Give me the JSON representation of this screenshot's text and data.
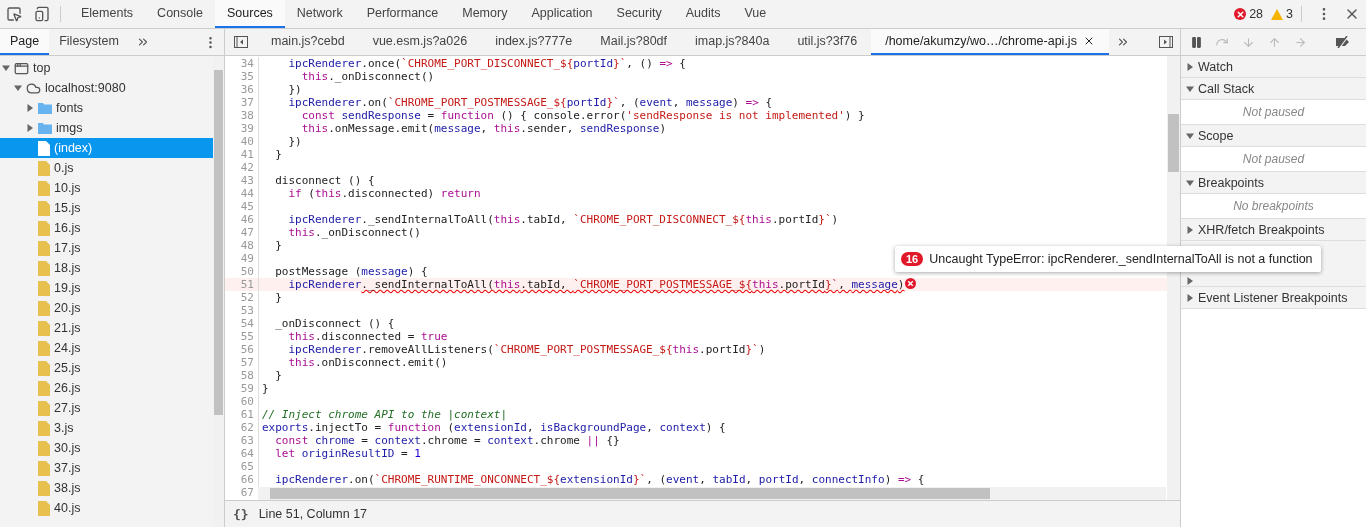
{
  "toolbar": {
    "tabs": [
      {
        "label": "Elements",
        "selected": false
      },
      {
        "label": "Console",
        "selected": false
      },
      {
        "label": "Sources",
        "selected": true
      },
      {
        "label": "Network",
        "selected": false
      },
      {
        "label": "Performance",
        "selected": false
      },
      {
        "label": "Memory",
        "selected": false
      },
      {
        "label": "Application",
        "selected": false
      },
      {
        "label": "Security",
        "selected": false
      },
      {
        "label": "Audits",
        "selected": false
      },
      {
        "label": "Vue",
        "selected": false
      }
    ],
    "errors": "28",
    "warnings": "3"
  },
  "navigator": {
    "tabs": [
      {
        "label": "Page",
        "selected": true
      },
      {
        "label": "Filesystem",
        "selected": false
      }
    ],
    "tree": [
      {
        "label": "top",
        "kind": "frame",
        "expanded": true,
        "selected": false,
        "children": [
          {
            "label": "localhost:9080",
            "kind": "domain",
            "expanded": true,
            "selected": false,
            "children": [
              {
                "label": "fonts",
                "kind": "folder",
                "expanded": false,
                "selected": false
              },
              {
                "label": "imgs",
                "kind": "folder",
                "expanded": false,
                "selected": false
              },
              {
                "label": "(index)",
                "kind": "document",
                "selected": true
              },
              {
                "label": "0.js",
                "kind": "script",
                "selected": false
              },
              {
                "label": "10.js",
                "kind": "script",
                "selected": false
              },
              {
                "label": "15.js",
                "kind": "script",
                "selected": false
              },
              {
                "label": "16.js",
                "kind": "script",
                "selected": false
              },
              {
                "label": "17.js",
                "kind": "script",
                "selected": false
              },
              {
                "label": "18.js",
                "kind": "script",
                "selected": false
              },
              {
                "label": "19.js",
                "kind": "script",
                "selected": false
              },
              {
                "label": "20.js",
                "kind": "script",
                "selected": false
              },
              {
                "label": "21.js",
                "kind": "script",
                "selected": false
              },
              {
                "label": "24.js",
                "kind": "script",
                "selected": false
              },
              {
                "label": "25.js",
                "kind": "script",
                "selected": false
              },
              {
                "label": "26.js",
                "kind": "script",
                "selected": false
              },
              {
                "label": "27.js",
                "kind": "script",
                "selected": false
              },
              {
                "label": "3.js",
                "kind": "script",
                "selected": false
              },
              {
                "label": "30.js",
                "kind": "script",
                "selected": false
              },
              {
                "label": "37.js",
                "kind": "script",
                "selected": false
              },
              {
                "label": "38.js",
                "kind": "script",
                "selected": false
              },
              {
                "label": "40.js",
                "kind": "script",
                "selected": false
              }
            ]
          }
        ]
      }
    ]
  },
  "editor": {
    "tabs": [
      {
        "label": "main.js?cebd",
        "selected": false
      },
      {
        "label": "vue.esm.js?a026",
        "selected": false
      },
      {
        "label": "index.js?777e",
        "selected": false
      },
      {
        "label": "Mail.js?80df",
        "selected": false
      },
      {
        "label": "imap.js?840a",
        "selected": false
      },
      {
        "label": "util.js?3f76",
        "selected": false
      },
      {
        "label": "/home/akumzy/wo…/chrome-api.js",
        "selected": true
      }
    ],
    "lines": [
      {
        "number": "34",
        "tokens": [
          {
            "kind": "variable",
            "text": "    ipcRenderer"
          },
          {
            "kind": "plain",
            "text": ".once("
          },
          {
            "kind": "string",
            "text": "`CHROME_PORT_DISCONNECT_${"
          },
          {
            "kind": "variable",
            "text": "portId"
          },
          {
            "kind": "string",
            "text": "}`"
          },
          {
            "kind": "plain",
            "text": ", () "
          },
          {
            "kind": "keyword",
            "text": "=>"
          },
          {
            "kind": "plain",
            "text": " {"
          }
        ]
      },
      {
        "number": "35",
        "tokens": [
          {
            "kind": "keyword",
            "text": "      this"
          },
          {
            "kind": "plain",
            "text": "._onDisconnect()"
          }
        ]
      },
      {
        "number": "36",
        "tokens": [
          {
            "kind": "plain",
            "text": "    })"
          }
        ]
      },
      {
        "number": "37",
        "tokens": [
          {
            "kind": "variable",
            "text": "    ipcRenderer"
          },
          {
            "kind": "plain",
            "text": ".on("
          },
          {
            "kind": "string",
            "text": "`CHROME_PORT_POSTMESSAGE_${"
          },
          {
            "kind": "variable",
            "text": "portId"
          },
          {
            "kind": "string",
            "text": "}`"
          },
          {
            "kind": "plain",
            "text": ", ("
          },
          {
            "kind": "variable",
            "text": "event"
          },
          {
            "kind": "plain",
            "text": ", "
          },
          {
            "kind": "variable",
            "text": "message"
          },
          {
            "kind": "plain",
            "text": ") "
          },
          {
            "kind": "keyword",
            "text": "=>"
          },
          {
            "kind": "plain",
            "text": " {"
          }
        ]
      },
      {
        "number": "38",
        "tokens": [
          {
            "kind": "keyword",
            "text": "      const "
          },
          {
            "kind": "variable",
            "text": "sendResponse"
          },
          {
            "kind": "plain",
            "text": " = "
          },
          {
            "kind": "keyword",
            "text": "function"
          },
          {
            "kind": "plain",
            "text": " () { console.error("
          },
          {
            "kind": "string",
            "text": "'sendResponse is not implemented'"
          },
          {
            "kind": "plain",
            "text": ") }"
          }
        ]
      },
      {
        "number": "39",
        "tokens": [
          {
            "kind": "keyword",
            "text": "      this"
          },
          {
            "kind": "plain",
            "text": ".onMessage.emit("
          },
          {
            "kind": "variable",
            "text": "message"
          },
          {
            "kind": "plain",
            "text": ", "
          },
          {
            "kind": "keyword",
            "text": "this"
          },
          {
            "kind": "plain",
            "text": ".sender, "
          },
          {
            "kind": "variable",
            "text": "sendResponse"
          },
          {
            "kind": "plain",
            "text": ")"
          }
        ]
      },
      {
        "number": "40",
        "tokens": [
          {
            "kind": "plain",
            "text": "    })"
          }
        ]
      },
      {
        "number": "41",
        "tokens": [
          {
            "kind": "plain",
            "text": "  }"
          }
        ]
      },
      {
        "number": "42"
      },
      {
        "number": "43",
        "tokens": [
          {
            "kind": "plain",
            "text": "  disconnect () {"
          }
        ]
      },
      {
        "number": "44",
        "tokens": [
          {
            "kind": "keyword",
            "text": "    if"
          },
          {
            "kind": "plain",
            "text": " ("
          },
          {
            "kind": "keyword",
            "text": "this"
          },
          {
            "kind": "plain",
            "text": ".disconnected) "
          },
          {
            "kind": "keyword",
            "text": "return"
          }
        ]
      },
      {
        "number": "45"
      },
      {
        "number": "46",
        "tokens": [
          {
            "kind": "variable",
            "text": "    ipcRenderer"
          },
          {
            "kind": "plain",
            "text": "._sendInternalToAll("
          },
          {
            "kind": "keyword",
            "text": "this"
          },
          {
            "kind": "plain",
            "text": ".tabId, "
          },
          {
            "kind": "string",
            "text": "`CHROME_PORT_DISCONNECT_${"
          },
          {
            "kind": "keyword",
            "text": "this"
          },
          {
            "kind": "plain",
            "text": ".portId"
          },
          {
            "kind": "string",
            "text": "}`"
          },
          {
            "kind": "plain",
            "text": ")"
          }
        ]
      },
      {
        "number": "47",
        "tokens": [
          {
            "kind": "keyword",
            "text": "    this"
          },
          {
            "kind": "plain",
            "text": "._onDisconnect()"
          }
        ]
      },
      {
        "number": "48",
        "tokens": [
          {
            "kind": "plain",
            "text": "  }"
          }
        ]
      },
      {
        "number": "49"
      },
      {
        "number": "50",
        "tokens": [
          {
            "kind": "plain",
            "text": "  postMessage ("
          },
          {
            "kind": "variable",
            "text": "message"
          },
          {
            "kind": "plain",
            "text": ") {"
          }
        ]
      },
      {
        "number": "51",
        "error": true,
        "tokens": [
          {
            "kind": "variable",
            "text": "    ipcRenderer"
          },
          {
            "kind": "plain",
            "text": "._sendInternalToAll("
          },
          {
            "kind": "keyword",
            "text": "this"
          },
          {
            "kind": "plain",
            "text": ".tabId, "
          },
          {
            "kind": "string",
            "text": "`CHROME_PORT_POSTMESSAGE_${"
          },
          {
            "kind": "keyword",
            "text": "this"
          },
          {
            "kind": "plain",
            "text": ".portId"
          },
          {
            "kind": "string",
            "text": "}`"
          },
          {
            "kind": "plain",
            "text": ", "
          },
          {
            "kind": "variable",
            "text": "message"
          },
          {
            "kind": "plain",
            "text": ")"
          }
        ]
      },
      {
        "number": "52",
        "tokens": [
          {
            "kind": "plain",
            "text": "  }"
          }
        ]
      },
      {
        "number": "53"
      },
      {
        "number": "54",
        "tokens": [
          {
            "kind": "plain",
            "text": "  _onDisconnect () {"
          }
        ]
      },
      {
        "number": "55",
        "tokens": [
          {
            "kind": "keyword",
            "text": "    this"
          },
          {
            "kind": "plain",
            "text": ".disconnected = "
          },
          {
            "kind": "keyword",
            "text": "true"
          }
        ]
      },
      {
        "number": "56",
        "tokens": [
          {
            "kind": "variable",
            "text": "    ipcRenderer"
          },
          {
            "kind": "plain",
            "text": ".removeAllListeners("
          },
          {
            "kind": "string",
            "text": "`CHROME_PORT_POSTMESSAGE_${"
          },
          {
            "kind": "keyword",
            "text": "this"
          },
          {
            "kind": "plain",
            "text": ".portId"
          },
          {
            "kind": "string",
            "text": "}`"
          },
          {
            "kind": "plain",
            "text": ")"
          }
        ]
      },
      {
        "number": "57",
        "tokens": [
          {
            "kind": "keyword",
            "text": "    this"
          },
          {
            "kind": "plain",
            "text": ".onDisconnect.emit()"
          }
        ]
      },
      {
        "number": "58",
        "tokens": [
          {
            "kind": "plain",
            "text": "  }"
          }
        ]
      },
      {
        "number": "59",
        "tokens": [
          {
            "kind": "plain",
            "text": "}"
          }
        ]
      },
      {
        "number": "60"
      },
      {
        "number": "61",
        "tokens": [
          {
            "kind": "comment",
            "text": "// Inject chrome API to the |context|"
          }
        ]
      },
      {
        "number": "62",
        "tokens": [
          {
            "kind": "variable",
            "text": "exports"
          },
          {
            "kind": "plain",
            "text": ".injectTo = "
          },
          {
            "kind": "keyword",
            "text": "function"
          },
          {
            "kind": "plain",
            "text": " ("
          },
          {
            "kind": "variable",
            "text": "extensionId"
          },
          {
            "kind": "plain",
            "text": ", "
          },
          {
            "kind": "variable",
            "text": "isBackgroundPage"
          },
          {
            "kind": "plain",
            "text": ", "
          },
          {
            "kind": "variable",
            "text": "context"
          },
          {
            "kind": "plain",
            "text": ") {"
          }
        ]
      },
      {
        "number": "63",
        "tokens": [
          {
            "kind": "keyword",
            "text": "  const "
          },
          {
            "kind": "variable",
            "text": "chrome"
          },
          {
            "kind": "plain",
            "text": " = "
          },
          {
            "kind": "variable",
            "text": "context"
          },
          {
            "kind": "plain",
            "text": ".chrome = "
          },
          {
            "kind": "variable",
            "text": "context"
          },
          {
            "kind": "plain",
            "text": ".chrome "
          },
          {
            "kind": "keyword",
            "text": "||"
          },
          {
            "kind": "plain",
            "text": " {}"
          }
        ]
      },
      {
        "number": "64",
        "tokens": [
          {
            "kind": "keyword",
            "text": "  let "
          },
          {
            "kind": "variable",
            "text": "originResultID"
          },
          {
            "kind": "plain",
            "text": " = "
          },
          {
            "kind": "number",
            "text": "1"
          }
        ]
      },
      {
        "number": "65"
      },
      {
        "number": "66",
        "tokens": [
          {
            "kind": "variable",
            "text": "  ipcRenderer"
          },
          {
            "kind": "plain",
            "text": ".on("
          },
          {
            "kind": "string",
            "text": "`CHROME_RUNTIME_ONCONNECT_${"
          },
          {
            "kind": "variable",
            "text": "extensionId"
          },
          {
            "kind": "string",
            "text": "}`"
          },
          {
            "kind": "plain",
            "text": ", ("
          },
          {
            "kind": "variable",
            "text": "event"
          },
          {
            "kind": "plain",
            "text": ", "
          },
          {
            "kind": "variable",
            "text": "tabId"
          },
          {
            "kind": "plain",
            "text": ", "
          },
          {
            "kind": "variable",
            "text": "portId"
          },
          {
            "kind": "plain",
            "text": ", "
          },
          {
            "kind": "variable",
            "text": "connectInfo"
          },
          {
            "kind": "plain",
            "text": ") "
          },
          {
            "kind": "keyword",
            "text": "=>"
          },
          {
            "kind": "plain",
            "text": " {"
          }
        ]
      },
      {
        "number": "67"
      }
    ],
    "format_button": "{}",
    "status": "Line 51, Column 17"
  },
  "tooltip": {
    "count": "16",
    "message": "Uncaught TypeError: ipcRenderer._sendInternalToAll is not a function"
  },
  "debugger": {
    "sections": [
      {
        "title": "Watch",
        "expanded": false
      },
      {
        "title": "Call Stack",
        "expanded": true,
        "message": "Not paused"
      },
      {
        "title": "Scope",
        "expanded": true,
        "message": "Not paused"
      },
      {
        "title": "Breakpoints",
        "expanded": true,
        "message": "No breakpoints"
      },
      {
        "title": "XHR/fetch Breakpoints",
        "expanded": false
      },
      {
        "expanded": false
      },
      {
        "title": "Event Listener Breakpoints",
        "expanded": false
      }
    ]
  }
}
